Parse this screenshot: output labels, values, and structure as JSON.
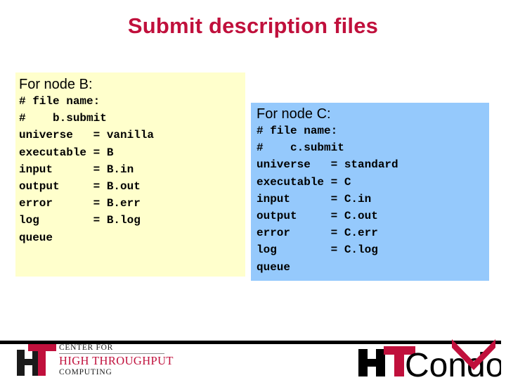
{
  "slide": {
    "title": "Submit description files",
    "title_color": "#c0103c",
    "background": "#ffffff"
  },
  "panels": [
    {
      "id": "node-b",
      "heading": "For node B:",
      "background_color": "#ffffcc",
      "code_lines": [
        "# file name:",
        "#    b.submit",
        "universe   = vanilla",
        "executable = B",
        "input      = B.in",
        "output     = B.out",
        "error      = B.err",
        "log        = B.log",
        "queue"
      ],
      "code_text": "# file name:\n#    b.submit\nuniverse   = vanilla\nexecutable = B\ninput      = B.in\noutput     = B.out\nerror      = B.err\nlog        = B.log\nqueue"
    },
    {
      "id": "node-c",
      "heading": "For node C:",
      "background_color": "#95c9fc",
      "code_lines": [
        "# file name:",
        "#    c.submit",
        "universe   = standard",
        "executable = C",
        "input      = C.in",
        "output     = C.out",
        "error      = C.err",
        "log        = C.log",
        "queue"
      ],
      "code_text": "# file name:\n#    c.submit\nuniverse   = standard\nexecutable = C\ninput      = C.in\noutput     = C.out\nerror      = C.err\nlog        = C.log\nqueue"
    }
  ],
  "footer": {
    "chtc_logo": {
      "line1": "CENTER FOR",
      "line2": "HIGH THROUGHPUT",
      "line3": "COMPUTING",
      "mark_letters": "HT",
      "accent_color": "#c0103c",
      "mark_dark_color": "#1a1a1a"
    },
    "htcondor_logo": {
      "ht_text": "HT",
      "condor_text": "Condor",
      "accent_color": "#c0103c",
      "dark_color": "#000000"
    }
  }
}
